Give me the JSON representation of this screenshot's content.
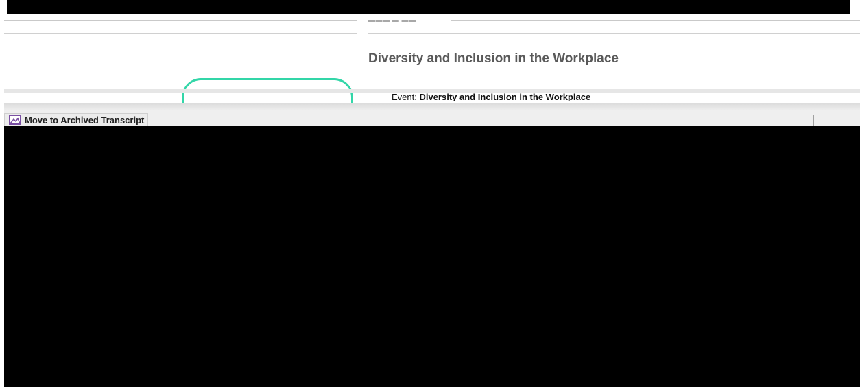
{
  "document": {
    "title": "Diversity and Inclusion in the Workplace",
    "event_prefix": "Event: ",
    "event_name": "Diversity and Inclusion in the Workplace"
  },
  "toolbar": {
    "move_archived_label": "Move to Archived Transcript",
    "move_archived_icon": "image-icon"
  },
  "colors": {
    "accent": "#33d6a8",
    "title_text": "#595959",
    "button_icon": "#7a4fa3"
  }
}
